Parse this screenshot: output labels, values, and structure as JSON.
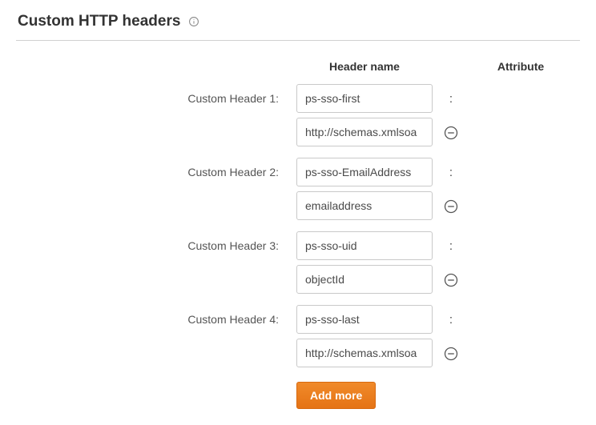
{
  "section": {
    "title": "Custom HTTP headers"
  },
  "columns": {
    "header_name": "Header name",
    "attribute": "Attribute"
  },
  "separator": ":",
  "rows": [
    {
      "label": "Custom Header 1:",
      "header_name": "ps-sso-first",
      "attribute": "http://schemas.xmlsoa"
    },
    {
      "label": "Custom Header 2:",
      "header_name": "ps-sso-EmailAddress",
      "attribute": "emailaddress"
    },
    {
      "label": "Custom Header 3:",
      "header_name": "ps-sso-uid",
      "attribute": "objectId"
    },
    {
      "label": "Custom Header 4:",
      "header_name": "ps-sso-last",
      "attribute": "http://schemas.xmlsoa"
    }
  ],
  "actions": {
    "add_more": "Add more"
  }
}
